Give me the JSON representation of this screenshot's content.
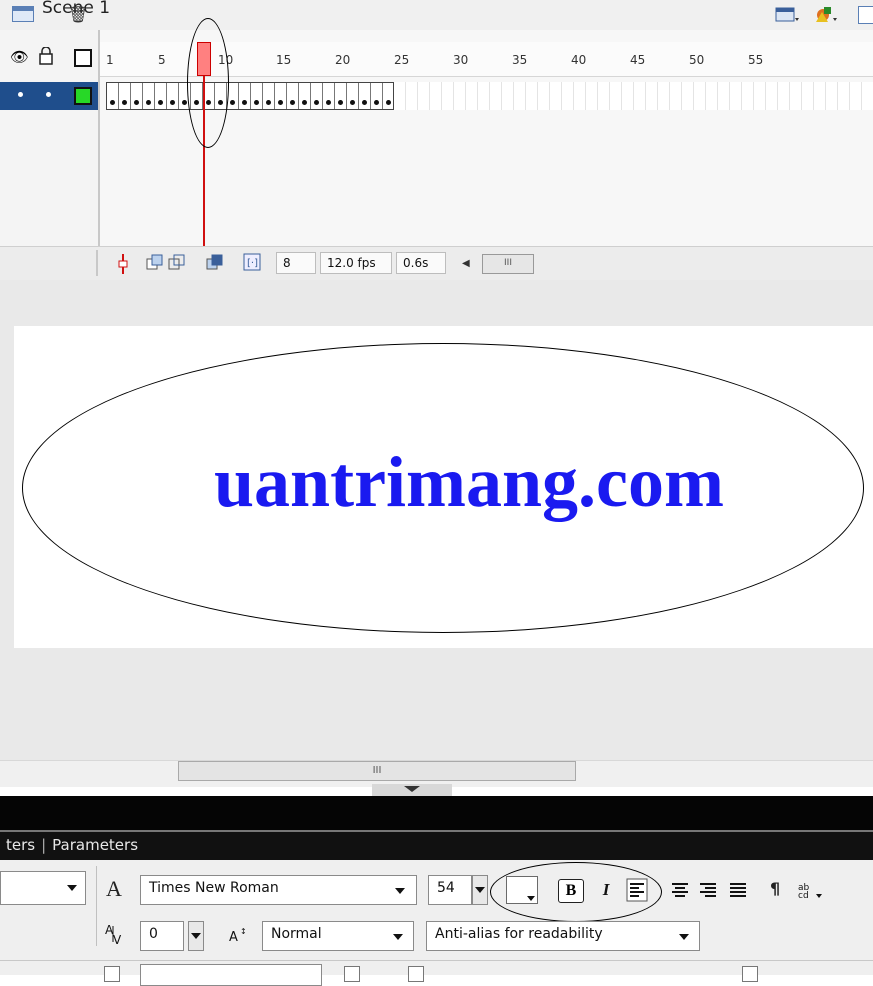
{
  "scene": {
    "title": "Scene 1"
  },
  "timeline": {
    "ruler_labels": [
      "1",
      "5",
      "10",
      "15",
      "20",
      "25",
      "30",
      "35",
      "40",
      "45",
      "50",
      "55"
    ],
    "current_frame": "8",
    "frame_rate": "12.0 fps",
    "elapsed_time": "0.6s"
  },
  "stage": {
    "text": "uantrimang.com"
  },
  "scrollbar": {
    "grip": "III"
  },
  "panel": {
    "tabs": [
      "ters",
      "Parameters"
    ]
  },
  "properties": {
    "font_family": "Times New Roman",
    "font_size": "54",
    "letter_spacing": "0",
    "baseline_shift": "Normal",
    "anti_alias": "Anti-alias for readability",
    "bold_label": "B",
    "italic_label": "I"
  },
  "colors": {
    "stage_text": "#1a1af0",
    "layer_selected": "#1f4e8c",
    "playhead": "#d01010"
  }
}
